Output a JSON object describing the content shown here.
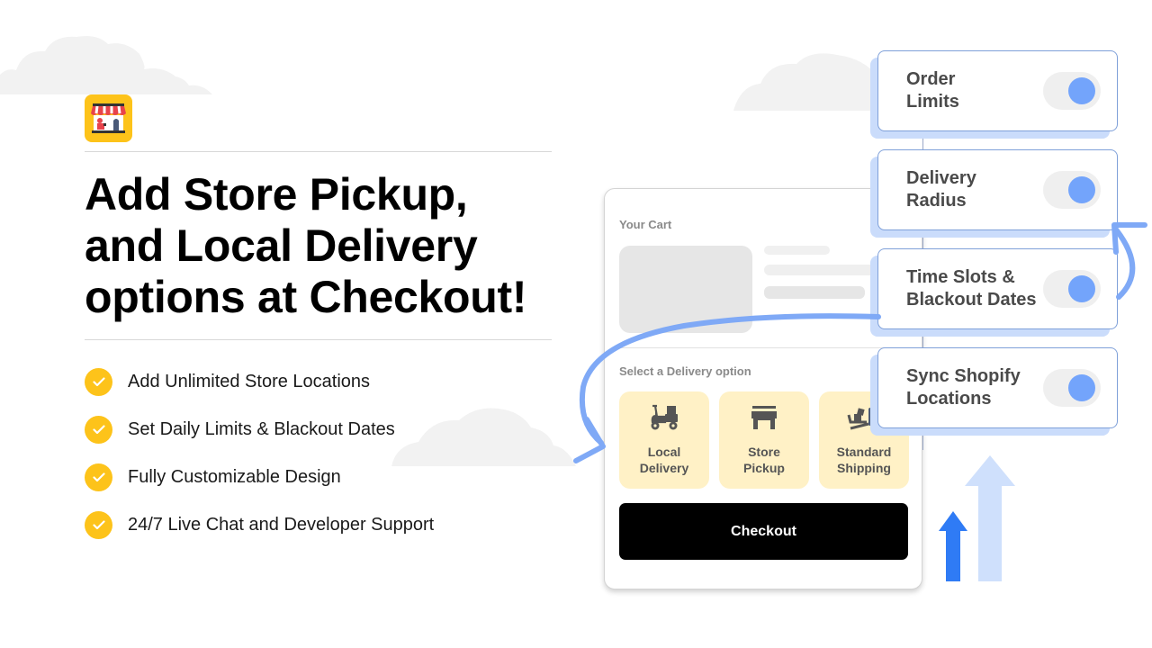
{
  "brand": {
    "logo_icon": "storefront-icon",
    "accent_color": "#fdc31a"
  },
  "headline": {
    "lines": [
      "Add Store Pickup,",
      "and Local Delivery",
      "options at Checkout!"
    ]
  },
  "features": [
    {
      "icon": "check-circle-icon",
      "label": "Add Unlimited Store Locations"
    },
    {
      "icon": "check-circle-icon",
      "label": "Set Daily Limits & Blackout Dates"
    },
    {
      "icon": "check-circle-icon",
      "label": "Fully Customizable Design"
    },
    {
      "icon": "check-circle-icon",
      "label": "24/7 Live Chat and Developer Support"
    }
  ],
  "cart": {
    "title": "Your Cart",
    "delivery_prompt": "Select a Delivery option",
    "options": [
      {
        "icon": "scooter-icon",
        "label": "Local\nDelivery"
      },
      {
        "icon": "store-icon",
        "label": "Store\nPickup"
      },
      {
        "icon": "hand-truck-icon",
        "label": "Standard\nShipping"
      }
    ],
    "checkout_label": "Checkout"
  },
  "settings": [
    {
      "label": "Order\nLimits",
      "enabled": true
    },
    {
      "label": "Delivery\nRadius",
      "enabled": true
    },
    {
      "label": "Time Slots &\nBlackout Dates",
      "enabled": true
    },
    {
      "label": "Sync Shopify\nLocations",
      "enabled": true
    }
  ],
  "colors": {
    "toggle_on": "#73a4fb",
    "arrow_primary": "#2f7bf5",
    "arrow_light": "#cfe0fc",
    "option_bg": "#fff1c6"
  }
}
